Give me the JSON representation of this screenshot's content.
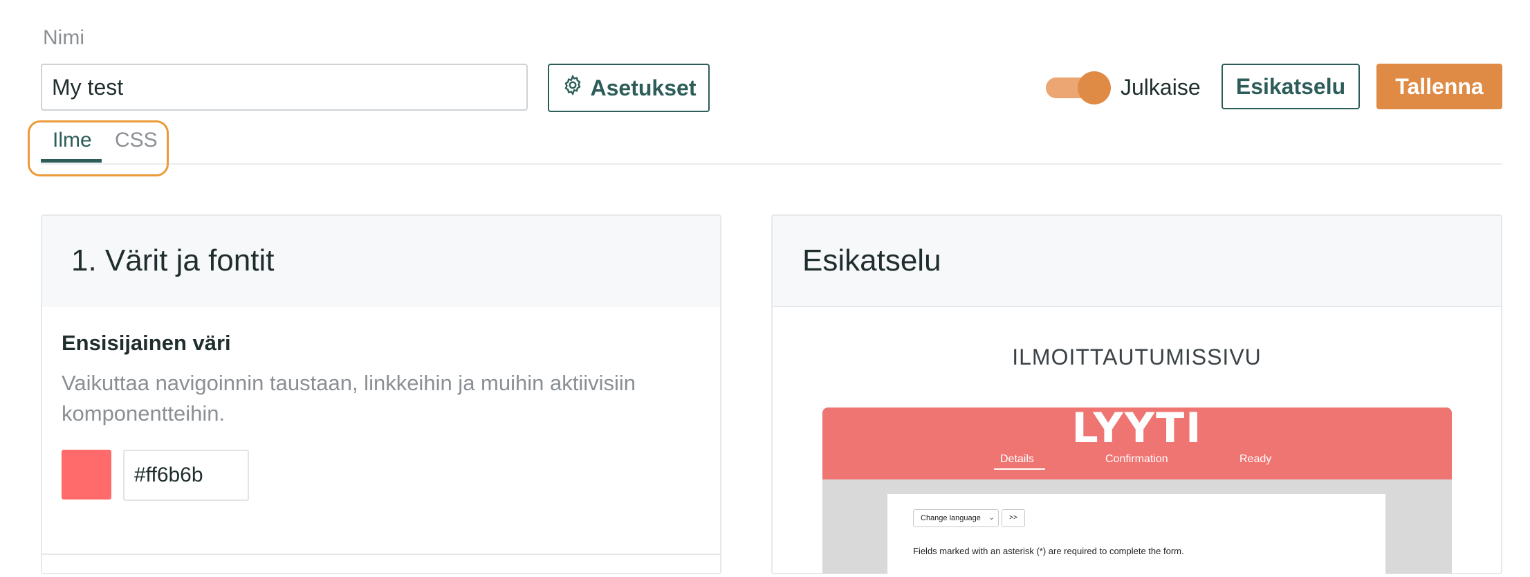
{
  "header": {
    "name_label": "Nimi",
    "name_value": "My test",
    "settings_label": "Asetukset",
    "publish_label": "Julkaise",
    "publish_on": true,
    "preview_label": "Esikatselu",
    "save_label": "Tallenna"
  },
  "tabs": [
    {
      "label": "Ilme",
      "active": true
    },
    {
      "label": "CSS",
      "active": false
    }
  ],
  "left_panel": {
    "title": "1. Värit ja fontit",
    "primary_color": {
      "title": "Ensisijainen väri",
      "description": "Vaikuttaa navigoinnin taustaan, linkkeihin ja muihin aktiivisiin komponentteihin.",
      "value": "#ff6b6b"
    }
  },
  "right_panel": {
    "title": "Esikatselu",
    "section_heading": "ILMOITTAUTUMISSIVU",
    "mock": {
      "logo": "LYYTI",
      "nav": [
        "Details",
        "Confirmation",
        "Ready"
      ],
      "language_select": "Change language",
      "go_button": ">>",
      "required_note": "Fields marked with an asterisk (*) are required to complete the form."
    }
  },
  "colors": {
    "brand_green": "#2c5d58",
    "accent_orange": "#e08b45",
    "highlight_outline": "#eb9a37",
    "primary_swatch": "#ff6b6b"
  },
  "icons": {
    "settings": "gear-icon",
    "select_caret": "chevron-down-icon"
  }
}
